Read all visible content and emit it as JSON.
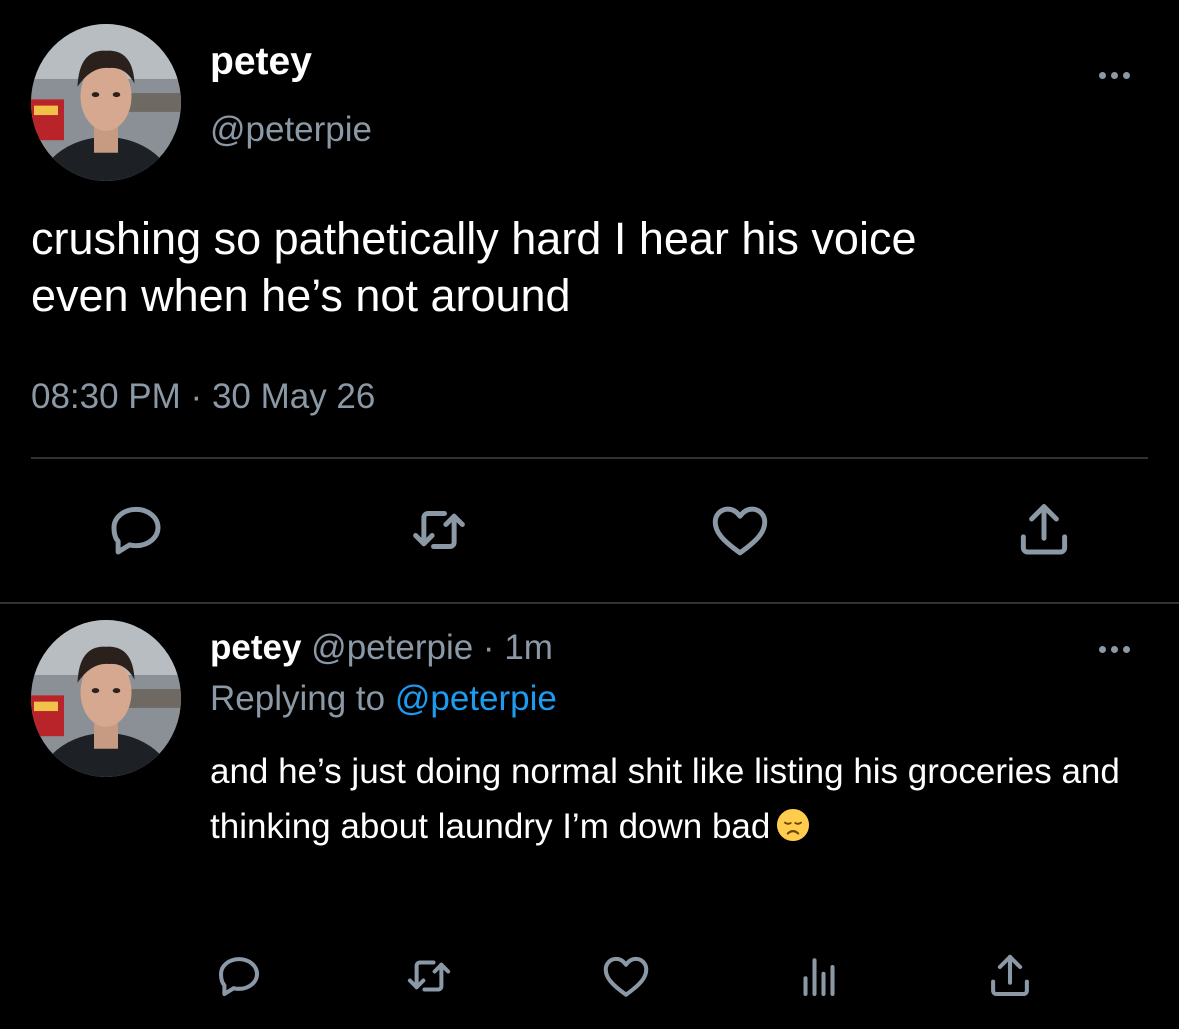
{
  "tweet": {
    "author": {
      "display_name": "petey",
      "handle": "@peterpie"
    },
    "text_line_1": "crushing so pathetically hard I hear his voice",
    "text_line_2": "even when he’s not around",
    "time": "08:30 PM",
    "separator": "·",
    "date": "30 May 26",
    "actions": [
      "reply-icon",
      "retweet-icon",
      "like-icon",
      "share-icon"
    ]
  },
  "reply": {
    "author": {
      "display_name": "petey",
      "handle": "@peterpie"
    },
    "separator": "·",
    "time_ago": "1m",
    "replying_prefix": "Replying to",
    "replying_to": "@peterpie",
    "text": "and he’s just doing normal shit like listing his groceries and thinking about laundry I’m down bad",
    "emoji": "disappointed-face-emoji",
    "actions": [
      "reply-icon",
      "retweet-icon",
      "like-icon",
      "analytics-icon",
      "share-icon"
    ]
  },
  "colors": {
    "background": "#000000",
    "primary_text": "#ffffff",
    "secondary_text": "#8b98a5",
    "link": "#1d9bf0",
    "divider": "#2f3336"
  }
}
